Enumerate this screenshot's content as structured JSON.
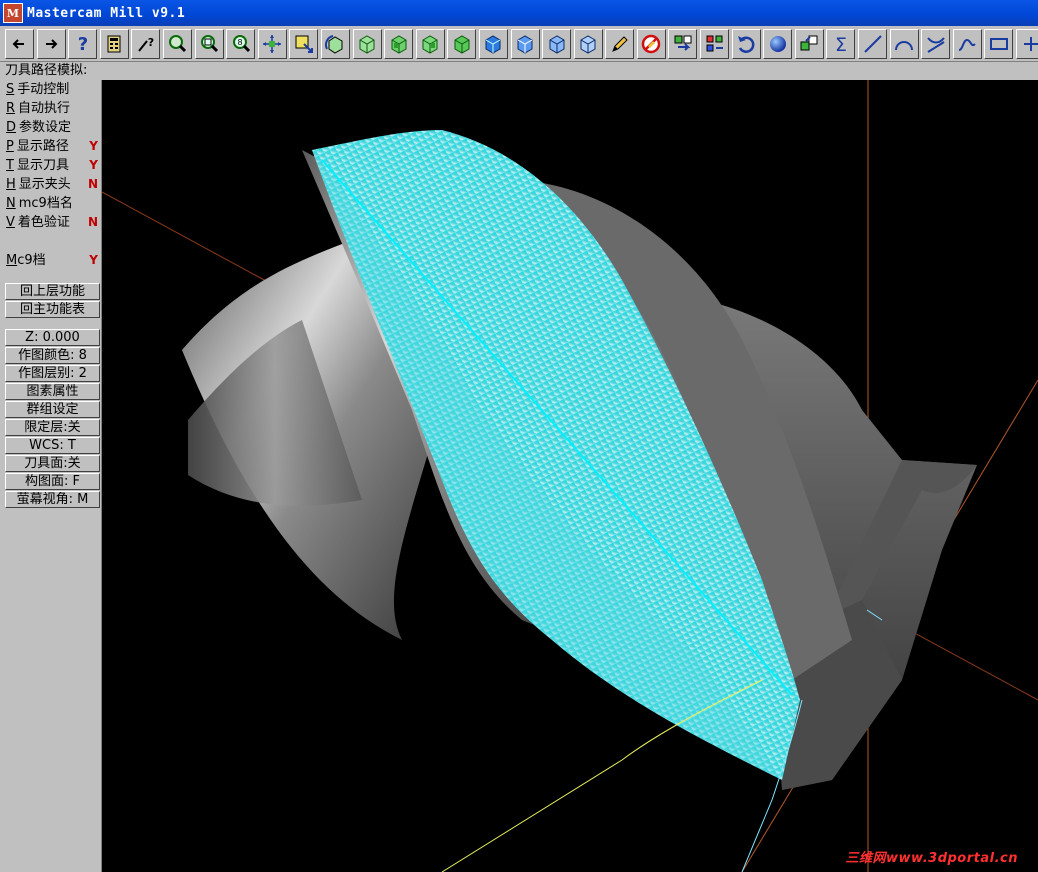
{
  "window": {
    "title": "Mastercam Mill v9.1",
    "icon_label": "M"
  },
  "toolbar": {
    "buttons": [
      {
        "name": "back-arrow-icon",
        "glyph": "←"
      },
      {
        "name": "forward-arrow-icon",
        "glyph": "→"
      },
      {
        "name": "help-icon",
        "glyph": "?"
      },
      {
        "name": "calculator-icon",
        "glyph": ""
      },
      {
        "name": "analyze-icon",
        "glyph": ""
      },
      {
        "name": "zoom-window-icon",
        "glyph": ""
      },
      {
        "name": "zoom-icon",
        "glyph": ""
      },
      {
        "name": "zoom-scale-icon",
        "glyph": ""
      },
      {
        "name": "pan-icon",
        "glyph": ""
      },
      {
        "name": "zoom-select-icon",
        "glyph": ""
      },
      {
        "name": "rotate-view-icon",
        "glyph": ""
      },
      {
        "name": "view-top-icon",
        "glyph": ""
      },
      {
        "name": "view-front-icon",
        "glyph": ""
      },
      {
        "name": "view-side-icon",
        "glyph": ""
      },
      {
        "name": "view-iso-icon",
        "glyph": ""
      },
      {
        "name": "cube-blue-1-icon",
        "glyph": ""
      },
      {
        "name": "cube-blue-2-icon",
        "glyph": ""
      },
      {
        "name": "cube-blue-3-icon",
        "glyph": ""
      },
      {
        "name": "cube-blue-4-icon",
        "glyph": ""
      },
      {
        "name": "pencil-icon",
        "glyph": ""
      },
      {
        "name": "no-erase-icon",
        "glyph": ""
      },
      {
        "name": "level-icon",
        "glyph": ""
      },
      {
        "name": "group-icon",
        "glyph": ""
      },
      {
        "name": "undo-icon",
        "glyph": ""
      },
      {
        "name": "sphere-icon",
        "glyph": ""
      },
      {
        "name": "transform-icon",
        "glyph": ""
      },
      {
        "name": "sigma-icon",
        "glyph": "Σ"
      },
      {
        "name": "line-icon",
        "glyph": ""
      },
      {
        "name": "arc-icon",
        "glyph": ""
      },
      {
        "name": "fillet-icon",
        "glyph": ""
      },
      {
        "name": "spline-icon",
        "glyph": ""
      },
      {
        "name": "rectangle-icon",
        "glyph": ""
      },
      {
        "name": "more-icon",
        "glyph": "+"
      }
    ]
  },
  "status": {
    "prompt": "刀具路径模拟:"
  },
  "menu": {
    "items": [
      {
        "key": "S",
        "label": "手动控制",
        "flag": ""
      },
      {
        "key": "R",
        "label": "自动执行",
        "flag": ""
      },
      {
        "key": "D",
        "label": "参数设定",
        "flag": ""
      },
      {
        "key": "P",
        "label": "显示路径",
        "flag": "Y"
      },
      {
        "key": "T",
        "label": "显示刀具",
        "flag": "Y"
      },
      {
        "key": "H",
        "label": "显示夹头",
        "flag": "N"
      },
      {
        "key": "N",
        "label": "mc9档名",
        "flag": ""
      },
      {
        "key": "V",
        "label": "着色验证",
        "flag": "N"
      }
    ],
    "mc9": {
      "key": "M",
      "label": "c9档",
      "flag": "Y"
    },
    "nav_buttons": [
      "回上层功能",
      "回主功能表"
    ],
    "secondary": [
      "Z:  0.000",
      "作图颜色: 8",
      "作图层别: 2",
      "图素属性",
      "群组设定",
      "限定层:关",
      "WCS:  T",
      "刀具面:关",
      "构图面: F",
      "萤幕视角: M"
    ]
  },
  "watermark": "三维网www.3dportal.cn",
  "colors": {
    "title_bar": "#0046d4",
    "toolpath": "#00e5ee",
    "viewport": "#000000",
    "flag": "#c00000"
  }
}
